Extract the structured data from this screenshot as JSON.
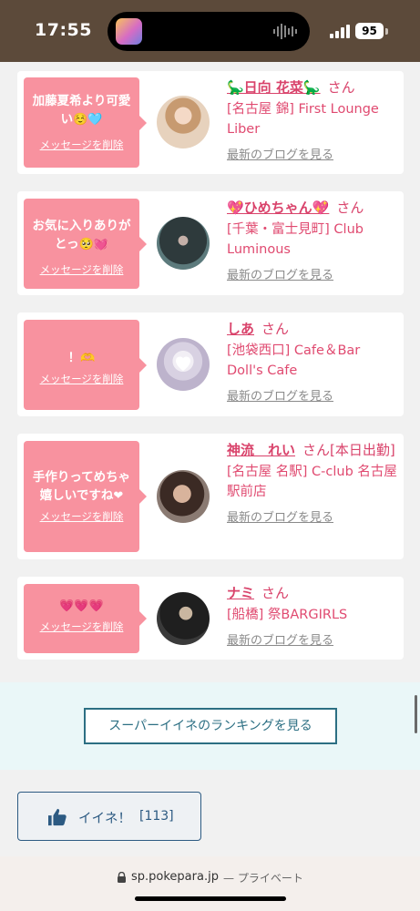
{
  "status_bar": {
    "time": "17:55",
    "battery": "95"
  },
  "cards": [
    {
      "message": "加藤夏希より可愛い",
      "emoji": "☺️🩵",
      "delete_label": "メッセージを削除",
      "name": "🦕日向 花菜🦕",
      "honorific": "さん",
      "shop": "[名古屋 錦] First Lounge Liber",
      "blog_link": "最新のブログを見る"
    },
    {
      "message": "お気に入りありがとっ",
      "emoji": "🥺💓",
      "delete_label": "メッセージを削除",
      "name": "💖ひめちゃん💖",
      "honorific": "さん",
      "shop": "[千葉・富士見町] Club Luminous",
      "blog_link": "最新のブログを見る"
    },
    {
      "message": "！",
      "emoji": "🫶",
      "delete_label": "メッセージを削除",
      "name": "しあ",
      "honorific": "さん",
      "shop": "[池袋西口] Cafe＆Bar Doll's Cafe",
      "blog_link": "最新のブログを見る"
    },
    {
      "message": "手作りってめちゃ嬉しいですね",
      "emoji": "❤",
      "delete_label": "メッセージを削除",
      "name": "神流　れい",
      "honorific": "さん[本日出勤]",
      "shop": "[名古屋 名駅] C-club 名古屋駅前店",
      "blog_link": "最新のブログを見る"
    },
    {
      "message": "",
      "emoji": "💗💗💗",
      "delete_label": "メッセージを削除",
      "name": "ナミ",
      "honorific": "さん",
      "shop": "[船橋] 祭BARGIRLS",
      "blog_link": "最新のブログを見る"
    }
  ],
  "ranking_button": "スーパーイイネのランキングを見る",
  "iine_button": {
    "label": "イイネ！",
    "count": "[113]",
    "icon": "thumbs-up-icon"
  },
  "browser": {
    "url": "sp.pokepara.jp",
    "mode": "— プライベート"
  },
  "colors": {
    "accent_pink": "#f8929f",
    "name_pink": "#d9436b",
    "brand_teal": "#2c6f83"
  }
}
